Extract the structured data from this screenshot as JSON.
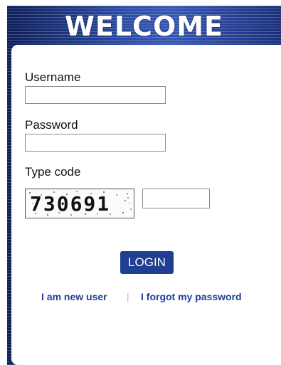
{
  "header": {
    "title": "WELCOME"
  },
  "form": {
    "username_label": "Username",
    "username_value": "",
    "password_label": "Password",
    "password_value": "",
    "code_label": "Type code",
    "captcha_text": "730691",
    "code_value": "",
    "login_label": "LOGIN"
  },
  "links": {
    "new_user": "I am new user",
    "separator": "|",
    "forgot_password": "I forgot my password"
  },
  "colors": {
    "accent": "#1f3f93",
    "header_dark": "#0d1e58",
    "header_light": "#3657b4"
  }
}
